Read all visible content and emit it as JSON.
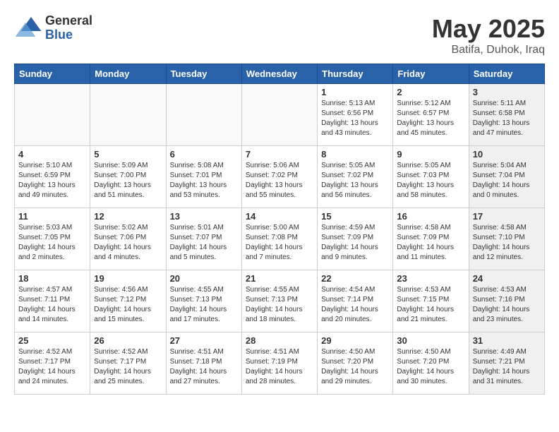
{
  "header": {
    "logo_general": "General",
    "logo_blue": "Blue",
    "month": "May 2025",
    "location": "Batifa, Duhok, Iraq"
  },
  "days_of_week": [
    "Sunday",
    "Monday",
    "Tuesday",
    "Wednesday",
    "Thursday",
    "Friday",
    "Saturday"
  ],
  "weeks": [
    [
      {
        "day": "",
        "info": "",
        "empty": true
      },
      {
        "day": "",
        "info": "",
        "empty": true
      },
      {
        "day": "",
        "info": "",
        "empty": true
      },
      {
        "day": "",
        "info": "",
        "empty": true
      },
      {
        "day": "1",
        "info": "Sunrise: 5:13 AM\nSunset: 6:56 PM\nDaylight: 13 hours\nand 43 minutes.",
        "shaded": false
      },
      {
        "day": "2",
        "info": "Sunrise: 5:12 AM\nSunset: 6:57 PM\nDaylight: 13 hours\nand 45 minutes.",
        "shaded": false
      },
      {
        "day": "3",
        "info": "Sunrise: 5:11 AM\nSunset: 6:58 PM\nDaylight: 13 hours\nand 47 minutes.",
        "shaded": true
      }
    ],
    [
      {
        "day": "4",
        "info": "Sunrise: 5:10 AM\nSunset: 6:59 PM\nDaylight: 13 hours\nand 49 minutes.",
        "shaded": false
      },
      {
        "day": "5",
        "info": "Sunrise: 5:09 AM\nSunset: 7:00 PM\nDaylight: 13 hours\nand 51 minutes.",
        "shaded": false
      },
      {
        "day": "6",
        "info": "Sunrise: 5:08 AM\nSunset: 7:01 PM\nDaylight: 13 hours\nand 53 minutes.",
        "shaded": false
      },
      {
        "day": "7",
        "info": "Sunrise: 5:06 AM\nSunset: 7:02 PM\nDaylight: 13 hours\nand 55 minutes.",
        "shaded": false
      },
      {
        "day": "8",
        "info": "Sunrise: 5:05 AM\nSunset: 7:02 PM\nDaylight: 13 hours\nand 56 minutes.",
        "shaded": false
      },
      {
        "day": "9",
        "info": "Sunrise: 5:05 AM\nSunset: 7:03 PM\nDaylight: 13 hours\nand 58 minutes.",
        "shaded": false
      },
      {
        "day": "10",
        "info": "Sunrise: 5:04 AM\nSunset: 7:04 PM\nDaylight: 14 hours\nand 0 minutes.",
        "shaded": true
      }
    ],
    [
      {
        "day": "11",
        "info": "Sunrise: 5:03 AM\nSunset: 7:05 PM\nDaylight: 14 hours\nand 2 minutes.",
        "shaded": false
      },
      {
        "day": "12",
        "info": "Sunrise: 5:02 AM\nSunset: 7:06 PM\nDaylight: 14 hours\nand 4 minutes.",
        "shaded": false
      },
      {
        "day": "13",
        "info": "Sunrise: 5:01 AM\nSunset: 7:07 PM\nDaylight: 14 hours\nand 5 minutes.",
        "shaded": false
      },
      {
        "day": "14",
        "info": "Sunrise: 5:00 AM\nSunset: 7:08 PM\nDaylight: 14 hours\nand 7 minutes.",
        "shaded": false
      },
      {
        "day": "15",
        "info": "Sunrise: 4:59 AM\nSunset: 7:09 PM\nDaylight: 14 hours\nand 9 minutes.",
        "shaded": false
      },
      {
        "day": "16",
        "info": "Sunrise: 4:58 AM\nSunset: 7:09 PM\nDaylight: 14 hours\nand 11 minutes.",
        "shaded": false
      },
      {
        "day": "17",
        "info": "Sunrise: 4:58 AM\nSunset: 7:10 PM\nDaylight: 14 hours\nand 12 minutes.",
        "shaded": true
      }
    ],
    [
      {
        "day": "18",
        "info": "Sunrise: 4:57 AM\nSunset: 7:11 PM\nDaylight: 14 hours\nand 14 minutes.",
        "shaded": false
      },
      {
        "day": "19",
        "info": "Sunrise: 4:56 AM\nSunset: 7:12 PM\nDaylight: 14 hours\nand 15 minutes.",
        "shaded": false
      },
      {
        "day": "20",
        "info": "Sunrise: 4:55 AM\nSunset: 7:13 PM\nDaylight: 14 hours\nand 17 minutes.",
        "shaded": false
      },
      {
        "day": "21",
        "info": "Sunrise: 4:55 AM\nSunset: 7:13 PM\nDaylight: 14 hours\nand 18 minutes.",
        "shaded": false
      },
      {
        "day": "22",
        "info": "Sunrise: 4:54 AM\nSunset: 7:14 PM\nDaylight: 14 hours\nand 20 minutes.",
        "shaded": false
      },
      {
        "day": "23",
        "info": "Sunrise: 4:53 AM\nSunset: 7:15 PM\nDaylight: 14 hours\nand 21 minutes.",
        "shaded": false
      },
      {
        "day": "24",
        "info": "Sunrise: 4:53 AM\nSunset: 7:16 PM\nDaylight: 14 hours\nand 23 minutes.",
        "shaded": true
      }
    ],
    [
      {
        "day": "25",
        "info": "Sunrise: 4:52 AM\nSunset: 7:17 PM\nDaylight: 14 hours\nand 24 minutes.",
        "shaded": false
      },
      {
        "day": "26",
        "info": "Sunrise: 4:52 AM\nSunset: 7:17 PM\nDaylight: 14 hours\nand 25 minutes.",
        "shaded": false
      },
      {
        "day": "27",
        "info": "Sunrise: 4:51 AM\nSunset: 7:18 PM\nDaylight: 14 hours\nand 27 minutes.",
        "shaded": false
      },
      {
        "day": "28",
        "info": "Sunrise: 4:51 AM\nSunset: 7:19 PM\nDaylight: 14 hours\nand 28 minutes.",
        "shaded": false
      },
      {
        "day": "29",
        "info": "Sunrise: 4:50 AM\nSunset: 7:20 PM\nDaylight: 14 hours\nand 29 minutes.",
        "shaded": false
      },
      {
        "day": "30",
        "info": "Sunrise: 4:50 AM\nSunset: 7:20 PM\nDaylight: 14 hours\nand 30 minutes.",
        "shaded": false
      },
      {
        "day": "31",
        "info": "Sunrise: 4:49 AM\nSunset: 7:21 PM\nDaylight: 14 hours\nand 31 minutes.",
        "shaded": true
      }
    ]
  ]
}
